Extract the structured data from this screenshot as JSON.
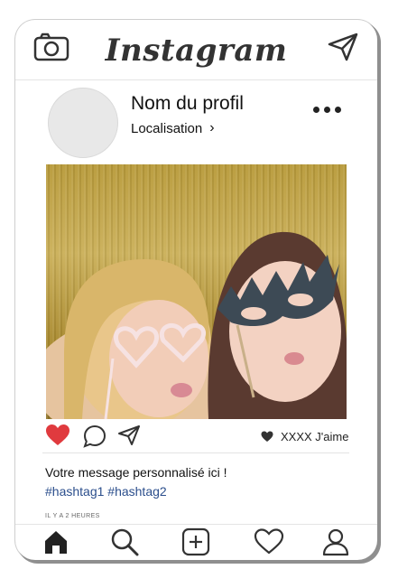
{
  "header": {
    "logo_text": "Instagram",
    "camera_icon": "camera-icon",
    "send_icon": "send-icon"
  },
  "profile": {
    "name": "Nom du profil",
    "location": "Localisation",
    "chevron": "›",
    "more_icon": "more-dots-icon"
  },
  "post": {
    "photo_icon": "photo",
    "liked": true,
    "like_color": "#e03a3e",
    "likes_text": "XXXX J'aime",
    "caption": "Votre message personnalisé ici !",
    "hashtags": "#hashtag1 #hashtag2",
    "time": "IL Y A 2 HEURES"
  },
  "nav": {
    "items": [
      {
        "icon": "home-icon"
      },
      {
        "icon": "search-icon"
      },
      {
        "icon": "add-icon"
      },
      {
        "icon": "heart-icon"
      },
      {
        "icon": "profile-icon"
      }
    ]
  },
  "colors": {
    "hashtag": "#2b4e8c",
    "heart": "#e03a3e",
    "icon": "#333333"
  }
}
